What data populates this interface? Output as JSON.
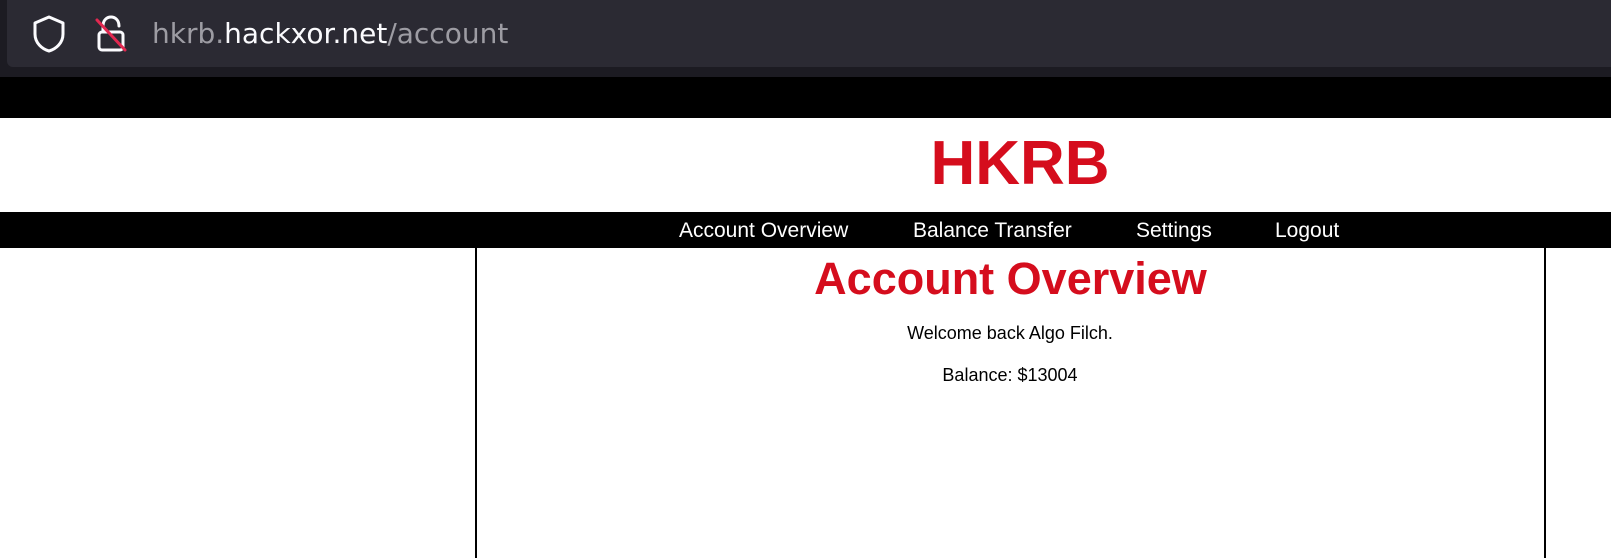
{
  "browser": {
    "url_prefix": "hkrb.",
    "url_domain": "hackxor.net",
    "url_path": "/account",
    "icons": [
      "shield-icon",
      "lock-insecure-icon"
    ]
  },
  "site": {
    "title": "HKRB"
  },
  "nav": {
    "items": [
      {
        "label": "Account Overview"
      },
      {
        "label": "Balance Transfer"
      },
      {
        "label": "Settings"
      },
      {
        "label": "Logout"
      }
    ]
  },
  "account": {
    "heading": "Account Overview",
    "welcome": "Welcome back Algo Filch.",
    "balance_label": "Balance: ",
    "balance_value": "$13004"
  },
  "colors": {
    "brand_red": "#d50d1d",
    "nav_background": "#000000",
    "browser_background": "#1c1b22"
  }
}
